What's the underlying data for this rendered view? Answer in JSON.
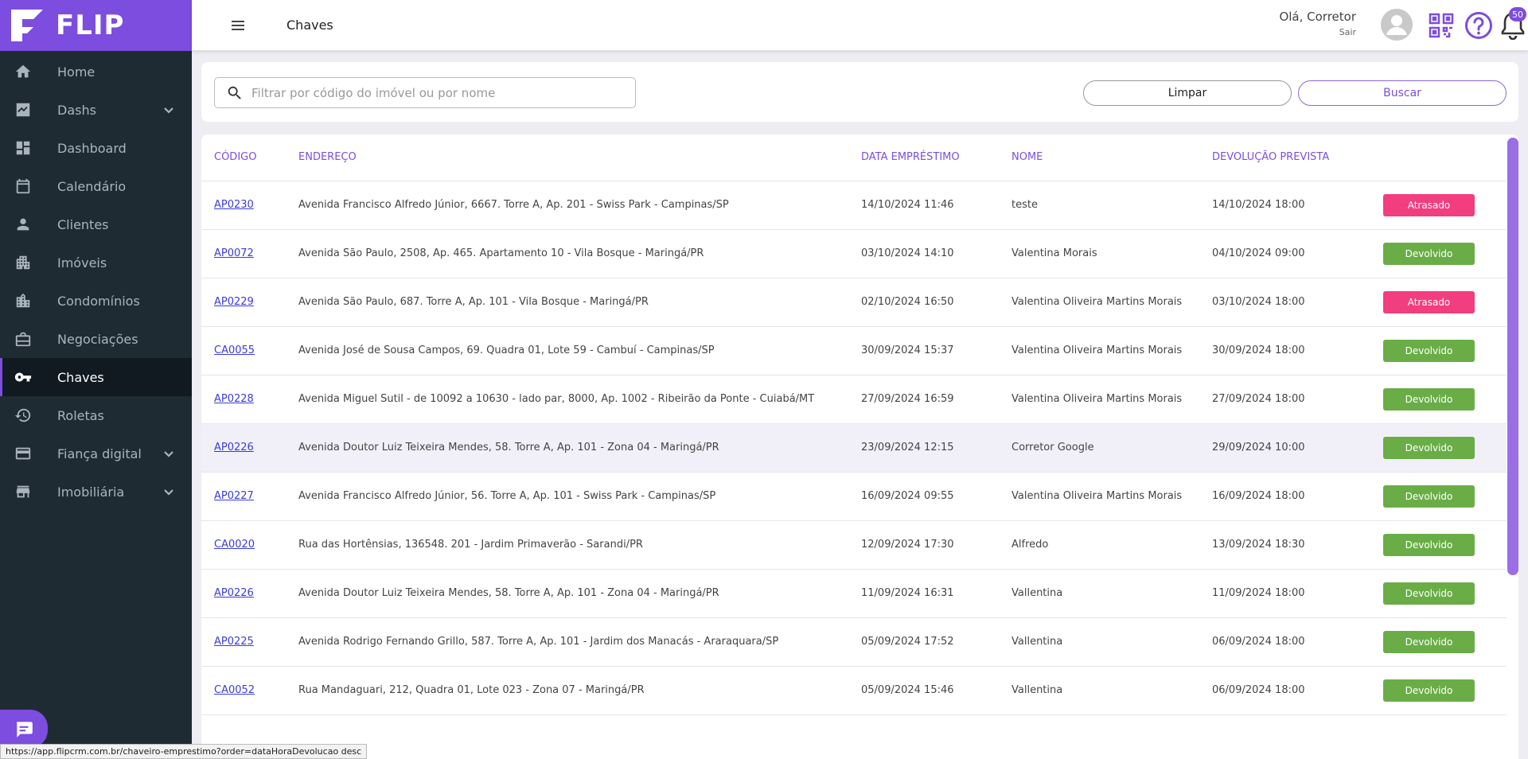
{
  "brand": {
    "name": "FLIP"
  },
  "sidebar": {
    "items": [
      {
        "label": "Home",
        "icon": "home-icon"
      },
      {
        "label": "Dashs",
        "icon": "chart-icon",
        "expandable": true
      },
      {
        "label": "Dashboard",
        "icon": "dashboard-icon"
      },
      {
        "label": "Calendário",
        "icon": "calendar-icon"
      },
      {
        "label": "Clientes",
        "icon": "person-icon"
      },
      {
        "label": "Imóveis",
        "icon": "building-icon"
      },
      {
        "label": "Condomínios",
        "icon": "city-icon"
      },
      {
        "label": "Negociações",
        "icon": "briefcase-icon"
      },
      {
        "label": "Chaves",
        "icon": "key-icon",
        "active": true
      },
      {
        "label": "Roletas",
        "icon": "history-icon"
      },
      {
        "label": "Fiança digital",
        "icon": "credit-card-icon",
        "expandable": true
      },
      {
        "label": "Imobiliária",
        "icon": "store-icon",
        "expandable": true
      }
    ]
  },
  "header": {
    "title": "Chaves",
    "greeting": "Olá, Corretor",
    "logout": "Sair",
    "notifications": "50"
  },
  "search": {
    "placeholder": "Filtrar por código do imóvel ou por nome",
    "clear_label": "Limpar",
    "search_label": "Buscar"
  },
  "table": {
    "columns": [
      "CÓDIGO",
      "ENDEREÇO",
      "DATA EMPRÉSTIMO",
      "NOME",
      "DEVOLUÇÃO PREVISTA",
      ""
    ],
    "rows": [
      {
        "code": "AP0230",
        "address": "Avenida Francisco Alfredo Júnior, 6667. Torre A, Ap. 201 - Swiss Park - Campinas/SP",
        "loan_date": "14/10/2024 11:46",
        "name": "teste",
        "due": "14/10/2024 18:00",
        "status": "Atrasado",
        "status_type": "late"
      },
      {
        "code": "AP0072",
        "address": "Avenida São Paulo, 2508, Ap. 465. Apartamento 10 - Vila Bosque - Maringá/PR",
        "loan_date": "03/10/2024 14:10",
        "name": "Valentina Morais",
        "due": "04/10/2024 09:00",
        "status": "Devolvido",
        "status_type": "returned"
      },
      {
        "code": "AP0229",
        "address": "Avenida São Paulo, 687. Torre A, Ap. 101 - Vila Bosque - Maringá/PR",
        "loan_date": "02/10/2024 16:50",
        "name": "Valentina Oliveira Martins Morais",
        "due": "03/10/2024 18:00",
        "status": "Atrasado",
        "status_type": "late"
      },
      {
        "code": "CA0055",
        "address": "Avenida José de Sousa Campos, 69. Quadra 01, Lote 59 - Cambuí - Campinas/SP",
        "loan_date": "30/09/2024 15:37",
        "name": "Valentina Oliveira Martins Morais",
        "due": "30/09/2024 18:00",
        "status": "Devolvido",
        "status_type": "returned"
      },
      {
        "code": "AP0228",
        "address": "Avenida Miguel Sutil - de 10092 a 10630 - lado par, 8000, Ap. 1002 - Ribeirão da Ponte - Cuiabá/MT",
        "loan_date": "27/09/2024 16:59",
        "name": "Valentina Oliveira Martins Morais",
        "due": "27/09/2024 18:00",
        "status": "Devolvido",
        "status_type": "returned"
      },
      {
        "code": "AP0226",
        "address": "Avenida Doutor Luiz Teixeira Mendes, 58. Torre A, Ap. 101 - Zona 04 - Maringá/PR",
        "loan_date": "23/09/2024 12:15",
        "name": "Corretor Google",
        "due": "29/09/2024 10:00",
        "status": "Devolvido",
        "status_type": "returned",
        "highlight": true
      },
      {
        "code": "AP0227",
        "address": "Avenida Francisco Alfredo Júnior, 56. Torre A, Ap. 101 - Swiss Park - Campinas/SP",
        "loan_date": "16/09/2024 09:55",
        "name": "Valentina Oliveira Martins Morais",
        "due": "16/09/2024 18:00",
        "status": "Devolvido",
        "status_type": "returned"
      },
      {
        "code": "CA0020",
        "address": "Rua das Hortênsias, 136548. 201 - Jardim Primaverão - Sarandi/PR",
        "loan_date": "12/09/2024 17:30",
        "name": "Alfredo",
        "due": "13/09/2024 18:30",
        "status": "Devolvido",
        "status_type": "returned"
      },
      {
        "code": "AP0226",
        "address": "Avenida Doutor Luiz Teixeira Mendes, 58. Torre A, Ap. 101 - Zona 04 - Maringá/PR",
        "loan_date": "11/09/2024 16:31",
        "name": "Vallentina",
        "due": "11/09/2024 18:00",
        "status": "Devolvido",
        "status_type": "returned"
      },
      {
        "code": "AP0225",
        "address": "Avenida Rodrigo Fernando Grillo, 587. Torre A, Ap. 101 - Jardim dos Manacás - Araraquara/SP",
        "loan_date": "05/09/2024 17:52",
        "name": "Vallentina",
        "due": "06/09/2024 18:00",
        "status": "Devolvido",
        "status_type": "returned"
      },
      {
        "code": "CA0052",
        "address": "Rua Mandaguari, 212, Quadra 01, Lote 023 - Zona 07 - Maringá/PR",
        "loan_date": "05/09/2024 15:46",
        "name": "Vallentina",
        "due": "06/09/2024 18:00",
        "status": "Devolvido",
        "status_type": "returned"
      }
    ]
  },
  "status_url": "https://app.flipcrm.com.br/chaveiro-emprestimo?order=dataHoraDevolucao desc",
  "colors": {
    "brand": "#7c4ddf",
    "sidebar": "#1f2b33",
    "late": "#f23d7e",
    "returned": "#6aad47"
  }
}
